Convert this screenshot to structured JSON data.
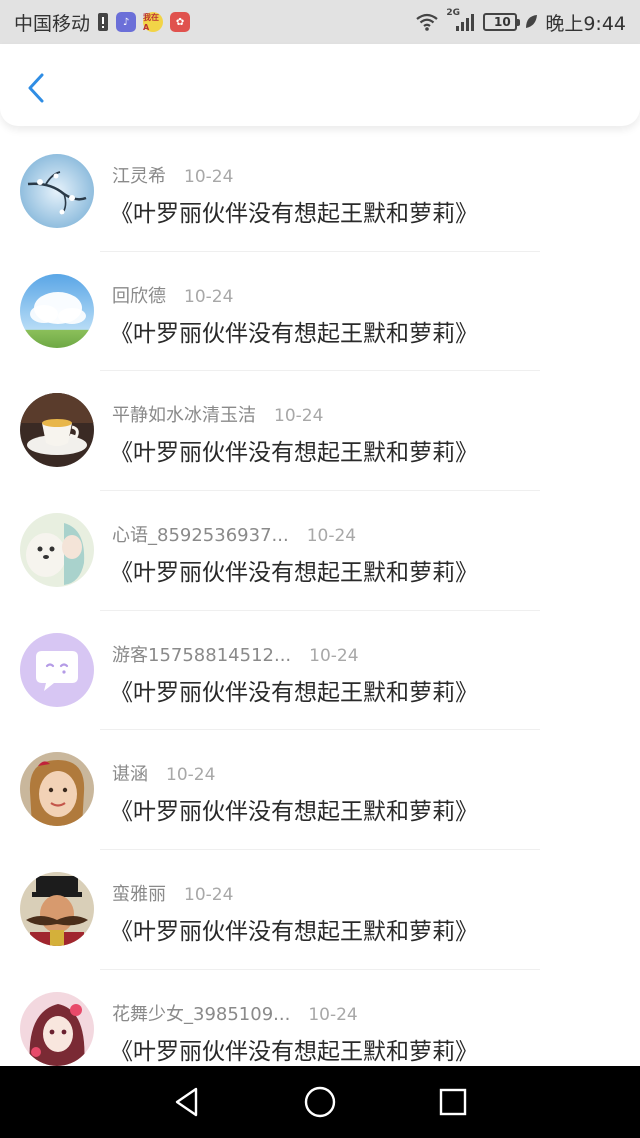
{
  "status_bar": {
    "carrier": "中国移动",
    "network": "2G",
    "battery": "10",
    "time": "晚上9:44",
    "badge_yellow": "我在A"
  },
  "comments": [
    {
      "name": "江灵希",
      "date": "10-24",
      "title": "《叶罗丽伙伴没有想起王默和萝莉》",
      "avatar": "winter-branch"
    },
    {
      "name": "回欣德",
      "date": "10-24",
      "title": "《叶罗丽伙伴没有想起王默和萝莉》",
      "avatar": "sky-clouds"
    },
    {
      "name": "平静如水冰清玉洁",
      "date": "10-24",
      "title": "《叶罗丽伙伴没有想起王默和萝莉》",
      "avatar": "teacup"
    },
    {
      "name": "心语_8592536937...",
      "date": "10-24",
      "title": "《叶罗丽伙伴没有想起王默和萝莉》",
      "avatar": "anime-girl-dog"
    },
    {
      "name": "游客15758814512...",
      "date": "10-24",
      "title": "《叶罗丽伙伴没有想起王默和萝莉》",
      "avatar": "chat-bubble"
    },
    {
      "name": "谌涵",
      "date": "10-24",
      "title": "《叶罗丽伙伴没有想起王默和萝莉》",
      "avatar": "little-girl"
    },
    {
      "name": "蛮雅丽",
      "date": "10-24",
      "title": "《叶罗丽伙伴没有想起王默和萝莉》",
      "avatar": "mustache-man"
    },
    {
      "name": "花舞少女_3985109...",
      "date": "10-24",
      "title": "《叶罗丽伙伴没有想起王默和萝莉》",
      "avatar": "anime-girl-red"
    }
  ]
}
